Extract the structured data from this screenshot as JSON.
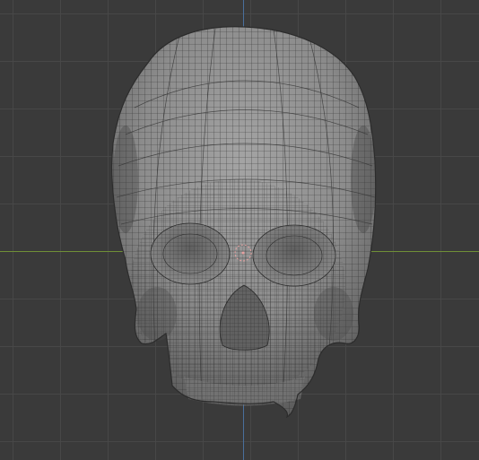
{
  "viewport": {
    "background": "#3a3a3a",
    "grid_color": "#484848",
    "x_axis_color": "#6f8f37",
    "y_axis_color": "#4a6f9c"
  },
  "mesh": {
    "object": "skull",
    "shading": "solid-wireframe",
    "surface_color": "#8e8e8e",
    "wire_color": "#1f1f1f"
  },
  "origin_marker": {
    "color": "#e8a0a0"
  }
}
